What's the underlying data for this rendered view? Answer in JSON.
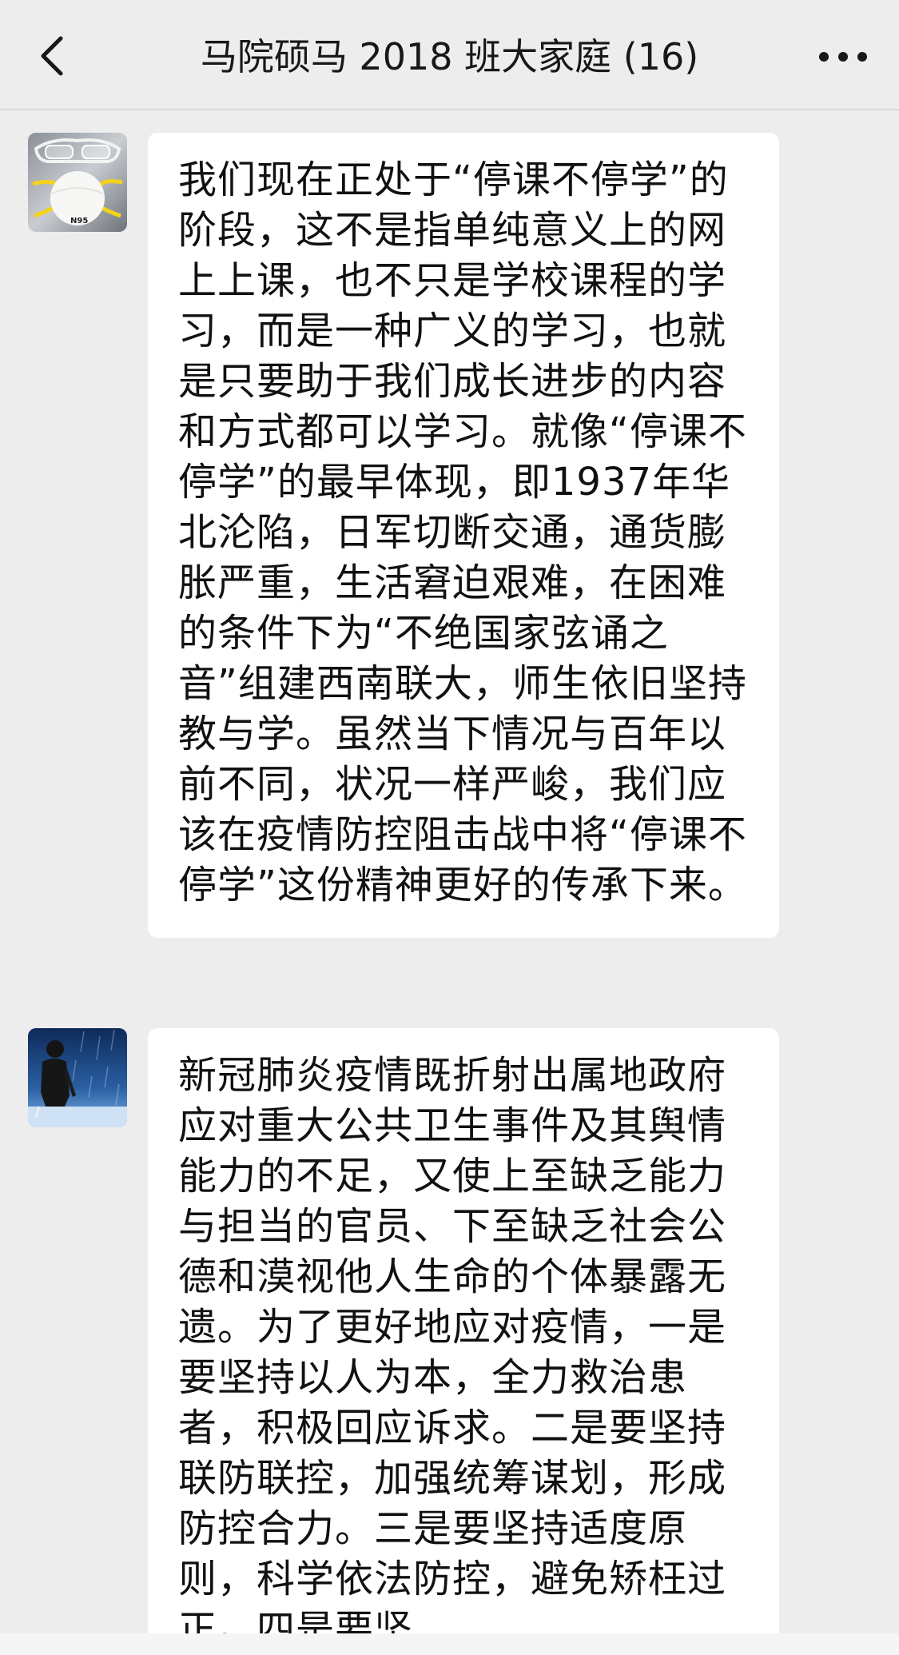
{
  "header": {
    "title": "马院硕马 2018 班大家庭 (16)",
    "back_icon": "chevron-left-icon",
    "more_icon": "more-dots-icon"
  },
  "messages": [
    {
      "avatar_icon": "n95-mask-avatar",
      "text": "我们现在正处于“停课不停学”的阶段，这不是指单纯意义上的网上上课，也不只是学校课程的学习，而是一种广义的学习，也就是只要助于我们成长进步的内容和方式都可以学习。就像“停课不停学”的最早体现，即1937年华北沦陷，日军切断交通，通货膨胀严重，生活窘迫艰难，在困难的条件下为“不绝国家弦诵之音”组建西南联大，师生依旧坚持教与学。虽然当下情况与百年以前不同，状况一样严峻，我们应该在疫情防控阻击战中将“停课不停学”这份精神更好的传承下来。"
    },
    {
      "avatar_icon": "person-in-rain-avatar",
      "text": "新冠肺炎疫情既折射出属地政府应对重大公共卫生事件及其舆情能力的不足，又使上至缺乏能力与担当的官员、下至缺乏社会公德和漠视他人生命的个体暴露无遗。为了更好地应对疫情，一是要坚持以人为本，全力救治患者，积极回应诉求。二是要坚持联防联控，加强统筹谋划，形成防控合力。三是要坚持适度原则，科学依法防控，避免矫枉过正。四是要坚"
    }
  ],
  "colors": {
    "background": "#ededed",
    "bubble": "#ffffff",
    "text": "#111111"
  }
}
